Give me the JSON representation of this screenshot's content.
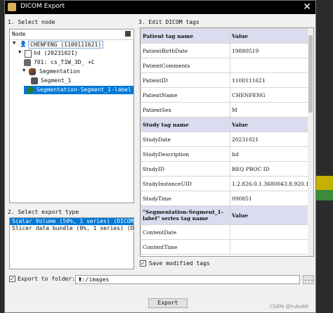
{
  "window": {
    "title": "DICOM Export"
  },
  "select_node": {
    "label": "1. Select node",
    "column": "Node",
    "items": [
      {
        "text": "CHENFENG (1100111621)"
      },
      {
        "text": "hd (20231021)"
      },
      {
        "text": "701: cs_T1W_3D_ +C"
      },
      {
        "text": "Segmentation"
      },
      {
        "text": "Segment_1"
      },
      {
        "text": "Segmentation-Segment_1-label"
      }
    ]
  },
  "export_type": {
    "label": "2. Select export type",
    "items": [
      "Scalar Volume (50%, 1 series) (DICOMScalarVolume",
      "Slicer data bundle (0%, 1 series) (DICOMSlicerDa"
    ]
  },
  "edit_tags": {
    "label": "3. Edit DICOM tags",
    "patient_header": {
      "name": "Patient tag name",
      "value": "Value"
    },
    "patient_rows": [
      {
        "name": "PatientBirthDate",
        "value": "19880519"
      },
      {
        "name": "PatientComments",
        "value": ""
      },
      {
        "name": "PatientID",
        "value": "1100111621"
      },
      {
        "name": "PatientName",
        "value": "CHENFENG"
      },
      {
        "name": "PatientSex",
        "value": "M"
      }
    ],
    "study_header": {
      "name": "Study tag name",
      "value": "Value"
    },
    "study_rows": [
      {
        "name": "StudyDate",
        "value": "20231021"
      },
      {
        "name": "StudyDescription",
        "value": "hd"
      },
      {
        "name": "StudyID",
        "value": "REQ PROC ID"
      },
      {
        "name": "StudyInstanceUID",
        "value": "1.2.826.0.1.3680043.8.920.10•••"
      },
      {
        "name": "StudyTime",
        "value": "090851"
      }
    ],
    "series_header": {
      "name": "\"Segmentation-Segment_1-label\" series tag name",
      "value": "Value"
    },
    "series_rows": [
      {
        "name": "ContentDate",
        "value": ""
      },
      {
        "name": "ContentTime",
        "value": ""
      }
    ]
  },
  "save_modified": {
    "label": "Save modified tags",
    "checked": true
  },
  "export_folder": {
    "label": "Export to folder:",
    "checked": true,
    "value": "L:/images",
    "browse": "..."
  },
  "export_button": "Export",
  "watermark": "CSDN @huko66"
}
